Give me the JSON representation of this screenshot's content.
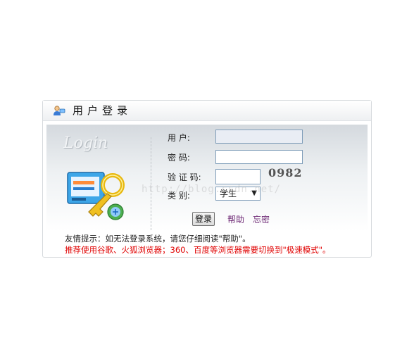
{
  "panel": {
    "title": "用户登录",
    "header_icon": "user-icon"
  },
  "login_art": {
    "script_text": "Login",
    "illustration": "key-icon"
  },
  "form": {
    "username_label": "用 户:",
    "password_label": "密 码:",
    "captcha_label": "验 证 码:",
    "captcha_code": "0982",
    "type_label": "类 别:",
    "type_selected": "学生",
    "login_button": "登录",
    "help_link": "帮助",
    "forgot_link": "忘密"
  },
  "watermark": "http://blog.csdn.net/",
  "hints": {
    "primary": "友情提示：如无法登录系统，请您仔细阅读\"帮助\"。",
    "warning": "推荐使用谷歌、火狐浏览器；360、百度等浏览器需要切换到\"极速模式\"。"
  },
  "colors": {
    "warning_text": "#e00000",
    "link_text": "#6f2a76",
    "input_border": "#7f9db9"
  }
}
